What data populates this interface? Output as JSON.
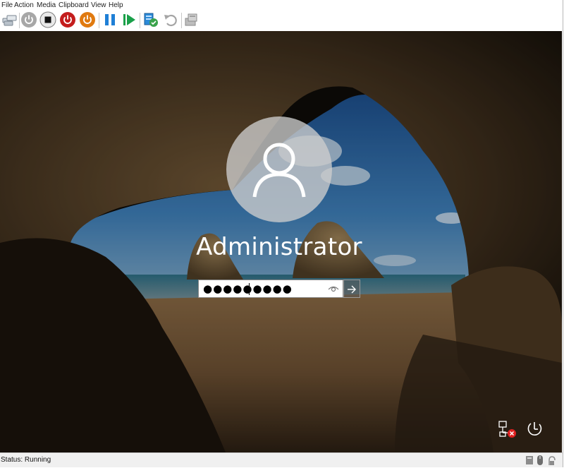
{
  "menu": {
    "items": [
      {
        "label": "File"
      },
      {
        "label": "Action"
      },
      {
        "label": "Media"
      },
      {
        "label": "Clipboard"
      },
      {
        "label": "View"
      },
      {
        "label": "Help"
      }
    ]
  },
  "toolbar": {
    "buttons": [
      {
        "icon": "ctrl-alt-del-icon"
      },
      {
        "icon": "start-icon"
      },
      {
        "icon": "turn-off-icon"
      },
      {
        "icon": "shut-down-icon"
      },
      {
        "icon": "save-state-icon"
      },
      {
        "icon": "pause-icon"
      },
      {
        "icon": "resume-icon"
      },
      {
        "icon": "checkpoint-icon"
      },
      {
        "icon": "revert-icon"
      },
      {
        "icon": "enhanced-session-icon"
      }
    ]
  },
  "login": {
    "username": "Administrator",
    "password_masked": "●●●●●●●●●",
    "reveal_icon": "eye-icon",
    "submit_icon": "arrow-right-icon"
  },
  "system_icons": {
    "network": "network-disconnected-icon",
    "power": "power-options-icon"
  },
  "statusbar": {
    "status": "Status: Running"
  },
  "colors": {
    "turn_off": "#c41d1d",
    "shut_down": "#e07a10",
    "pause": "#1f7fd6",
    "resume": "#1aa04a"
  }
}
